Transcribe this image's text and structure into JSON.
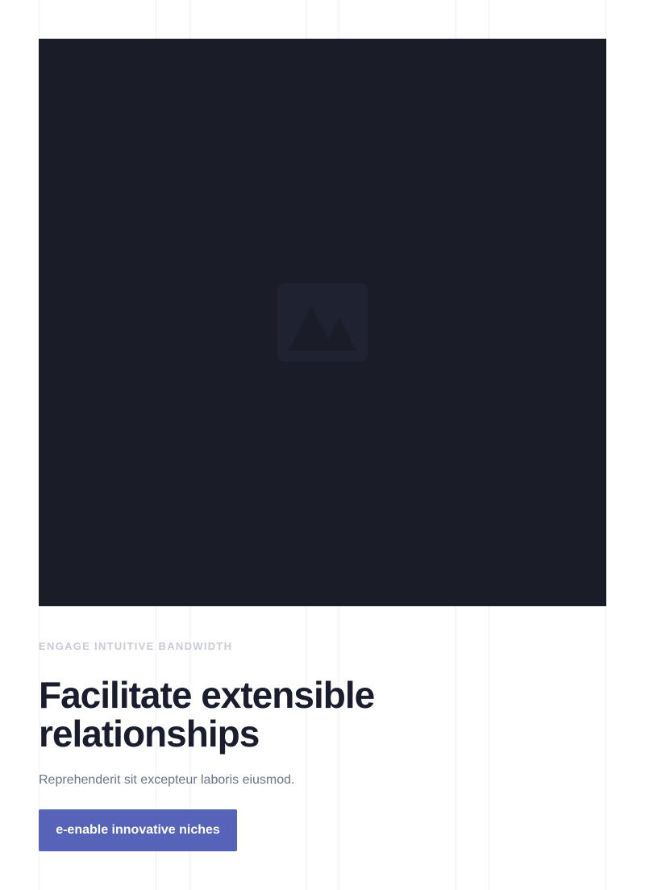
{
  "hero": {
    "image_icon": "image-placeholder-icon",
    "background_color": "#1a1d27"
  },
  "content": {
    "eyebrow": "ENGAGE INTUITIVE BANDWIDTH",
    "headline": "Facilitate extensible relationships",
    "subtext": "Reprehenderit sit excepteur laboris eiusmod.",
    "cta_label": "e-enable innovative niches"
  },
  "colors": {
    "accent": "#5563b8",
    "heading": "#1a1d2e",
    "body_text": "#6b7386",
    "eyebrow": "#c6cbd6"
  }
}
